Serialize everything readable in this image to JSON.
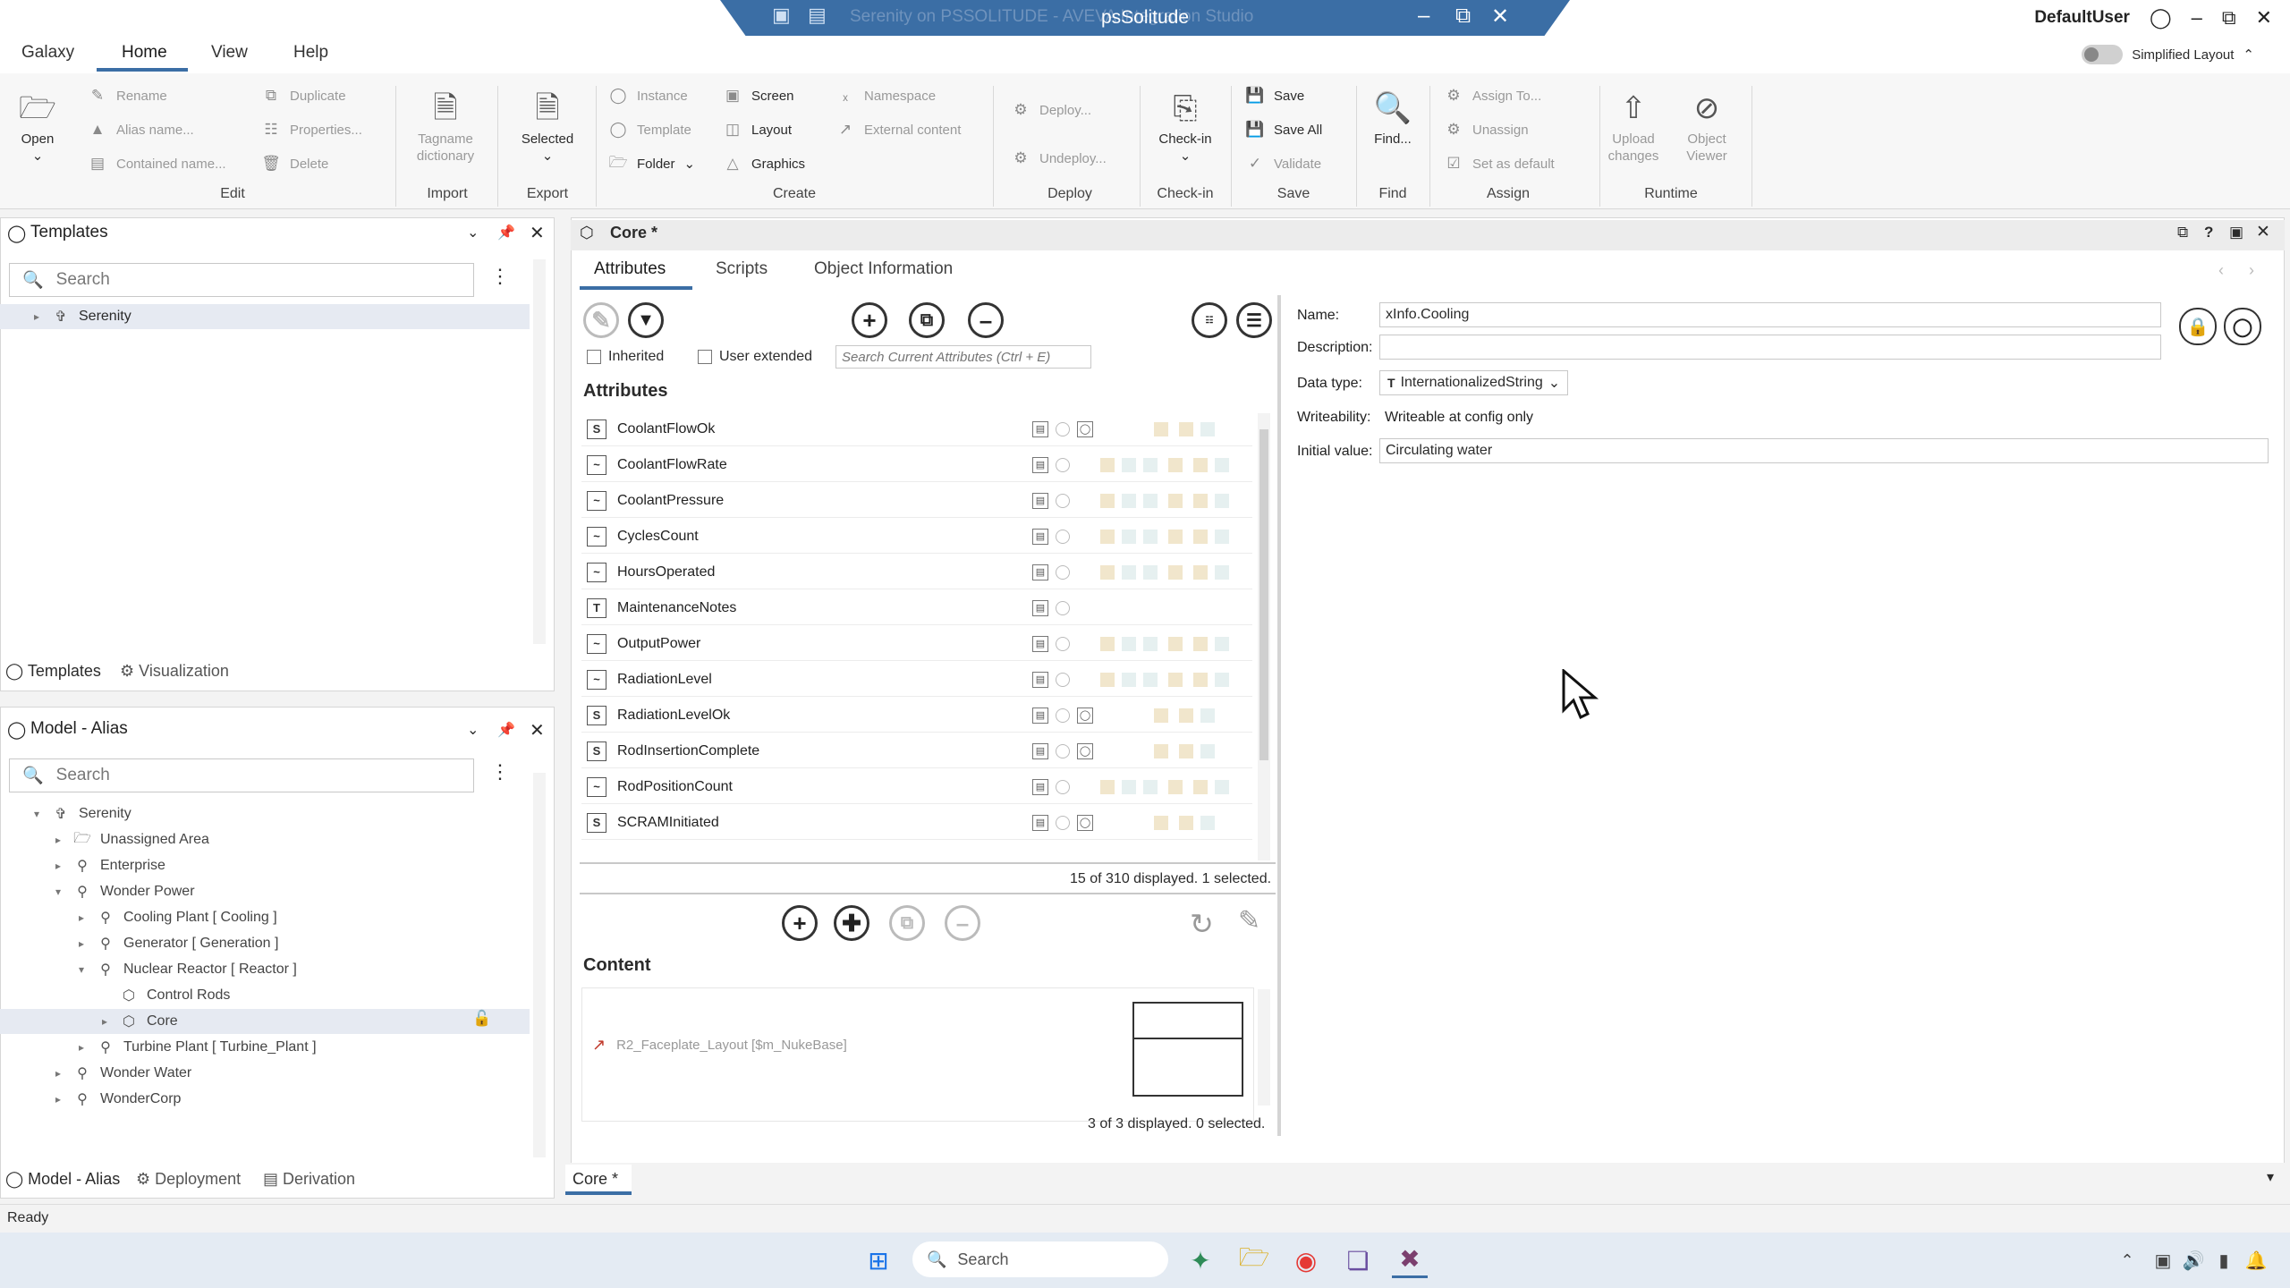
{
  "window": {
    "title": "psSolitude",
    "ghost_title": "Serenity on PSSOLITUDE - AVEVA Integration Studio",
    "user": "DefaultUser"
  },
  "menu": {
    "items": [
      "Galaxy",
      "Home",
      "View",
      "Help"
    ],
    "simplified_layout": "Simplified Layout"
  },
  "ribbon": {
    "open": "Open",
    "edit": {
      "rename": "Rename",
      "alias": "Alias name...",
      "contained": "Contained name...",
      "duplicate": "Duplicate",
      "properties": "Properties...",
      "delete": "Delete",
      "group": "Edit"
    },
    "import": {
      "tagname": "Tagname dictionary",
      "group": "Import"
    },
    "export": {
      "selected": "Selected",
      "group": "Export"
    },
    "create": {
      "instance": "Instance",
      "template": "Template",
      "folder": "Folder",
      "screen": "Screen",
      "layout": "Layout",
      "graphics": "Graphics",
      "namespace": "Namespace",
      "external": "External content",
      "group": "Create"
    },
    "deploy": {
      "deploy": "Deploy...",
      "undeploy": "Undeploy...",
      "group": "Deploy"
    },
    "checkin": {
      "label": "Check-in",
      "group": "Check-in"
    },
    "save": {
      "save": "Save",
      "save_all": "Save All",
      "validate": "Validate",
      "group": "Save"
    },
    "find": {
      "label": "Find...",
      "group": "Find"
    },
    "assign": {
      "assign_to": "Assign To...",
      "unassign": "Unassign",
      "set_default": "Set as default",
      "group": "Assign"
    },
    "runtime": {
      "upload": "Upload changes",
      "viewer": "Object Viewer",
      "group": "Runtime"
    }
  },
  "templates_panel": {
    "title": "Templates",
    "search": "Search",
    "items": [
      {
        "label": "Serenity"
      }
    ],
    "tabs": [
      "Templates",
      "Visualization"
    ]
  },
  "model_panel": {
    "title": "Model - Alias",
    "search": "Search",
    "items": [
      "Serenity",
      "Unassigned Area",
      "Enterprise",
      "Wonder Power",
      "Cooling Plant [ Cooling ]",
      "Generator [ Generation ]",
      "Nuclear Reactor [ Reactor ]",
      "Control Rods",
      "Core",
      "Turbine Plant [ Turbine_Plant ]",
      "Wonder Water",
      "WonderCorp"
    ],
    "tabs": [
      "Model - Alias",
      "Deployment",
      "Derivation"
    ]
  },
  "editor": {
    "title": "Core *",
    "tabs": [
      "Attributes",
      "Scripts",
      "Object Information"
    ],
    "inherited": "Inherited",
    "user_extended": "User extended",
    "search_placeholder": "Search Current Attributes (Ctrl + E)",
    "attributes_heading": "Attributes",
    "attributes": [
      {
        "name": "CoolantFlowOk",
        "type": "S"
      },
      {
        "name": "CoolantFlowRate",
        "type": "~"
      },
      {
        "name": "CoolantPressure",
        "type": "~"
      },
      {
        "name": "CyclesCount",
        "type": "~"
      },
      {
        "name": "HoursOperated",
        "type": "~"
      },
      {
        "name": "MaintenanceNotes",
        "type": "T"
      },
      {
        "name": "OutputPower",
        "type": "~"
      },
      {
        "name": "RadiationLevel",
        "type": "~"
      },
      {
        "name": "RadiationLevelOk",
        "type": "S"
      },
      {
        "name": "RodInsertionComplete",
        "type": "S"
      },
      {
        "name": "RodPositionCount",
        "type": "~"
      },
      {
        "name": "SCRAMInitiated",
        "type": "S"
      }
    ],
    "attr_count": "15 of 310 displayed. 1 selected.",
    "content_heading": "Content",
    "content_item": "R2_Faceplate_Layout [$m_NukeBase]",
    "content_count": "3 of 3 displayed. 0 selected.",
    "doc_tab": "Core *"
  },
  "properties": {
    "name_label": "Name:",
    "name": "xInfo.Cooling",
    "description_label": "Description:",
    "description": "",
    "datatype_label": "Data type:",
    "datatype": "InternationalizedString",
    "writeability_label": "Writeability:",
    "writeability": "Writeable at config only",
    "initial_label": "Initial value:",
    "initial": "Circulating water"
  },
  "status": "Ready",
  "taskbar": {
    "search": "Search"
  }
}
